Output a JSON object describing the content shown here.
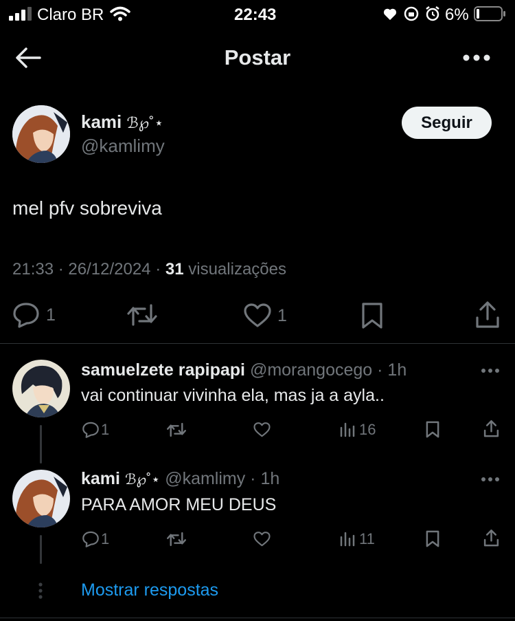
{
  "status_bar": {
    "carrier": "Claro BR",
    "time": "22:43",
    "battery": "6%"
  },
  "header": {
    "title": "Postar"
  },
  "post": {
    "author_name": "kami",
    "author_decoration": "ℬ℘˚⋆",
    "author_handle": "@kamlimy",
    "follow_label": "Seguir",
    "text": "mel pfv sobreviva",
    "time": "21:33",
    "date": "26/12/2024",
    "views_count": "31",
    "views_label": "visualizações",
    "replies": "1",
    "likes": "1"
  },
  "replies": [
    {
      "author_name": "samuelzete rapipapi",
      "author_handle": "@morangocego",
      "time": "1h",
      "text": "vai continuar vivinha ela, mas ja a ayla..",
      "replies": "1",
      "views": "16"
    },
    {
      "author_name": "kami",
      "author_decoration": "ℬ℘˚⋆",
      "author_handle": "@kamlimy",
      "time": "1h",
      "text": "PARA AMOR MEU DEUS",
      "replies": "1",
      "views": "11"
    }
  ],
  "show_replies": "Mostrar respostas",
  "colors": {
    "background": "#000000",
    "text": "#e7e9ea",
    "muted": "#71767b",
    "link": "#1d9bf0",
    "follow_bg": "#eff3f4"
  },
  "icons": [
    "signal-icon",
    "wifi-icon",
    "heart-status-icon",
    "lock-rotation-icon",
    "alarm-icon",
    "battery-icon",
    "back-arrow-icon",
    "more-icon",
    "reply-icon",
    "retweet-icon",
    "like-icon",
    "bookmark-icon",
    "share-icon",
    "views-icon"
  ]
}
